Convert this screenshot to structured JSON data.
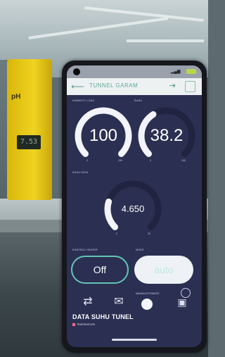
{
  "meter": {
    "label": "pH",
    "reading": "7.53"
  },
  "app": {
    "header_title": "TUNNEL GARAM",
    "back_icon": "back-arrow-icon",
    "header_icons": [
      "export-icon",
      "menu-icon"
    ]
  },
  "widgets": {
    "gauge1": {
      "label": "HUMIDITY LOKA",
      "value": "100",
      "min": "0",
      "max": "100",
      "fill": 1.0
    },
    "gauge2": {
      "label": "SUHU",
      "value": "38.2",
      "min": "0",
      "max": "100",
      "fill": 0.382
    },
    "gauge3": {
      "label": "SUHU RATA",
      "value": "4.650",
      "min": "0",
      "max": "20",
      "fill": 0.23
    },
    "switch_labels": {
      "left": "KONTROL HEATER",
      "right": "MODE"
    },
    "buttons": {
      "off": "Off",
      "auto": "auto"
    },
    "bottom_icons": [
      "route-icon",
      "mail-icon",
      "circle-button",
      "device-icon"
    ],
    "bottom_label": "MANUAL/OTOMATIS",
    "chart": {
      "title": "DATA SUHU TUNEL",
      "legend": "TEMPERATURE"
    }
  },
  "colors": {
    "accent": "#62c6b4",
    "screen_bg": "#2b2f52",
    "gauge_track": "#202440",
    "gauge_arc": "#f2f4fa"
  }
}
